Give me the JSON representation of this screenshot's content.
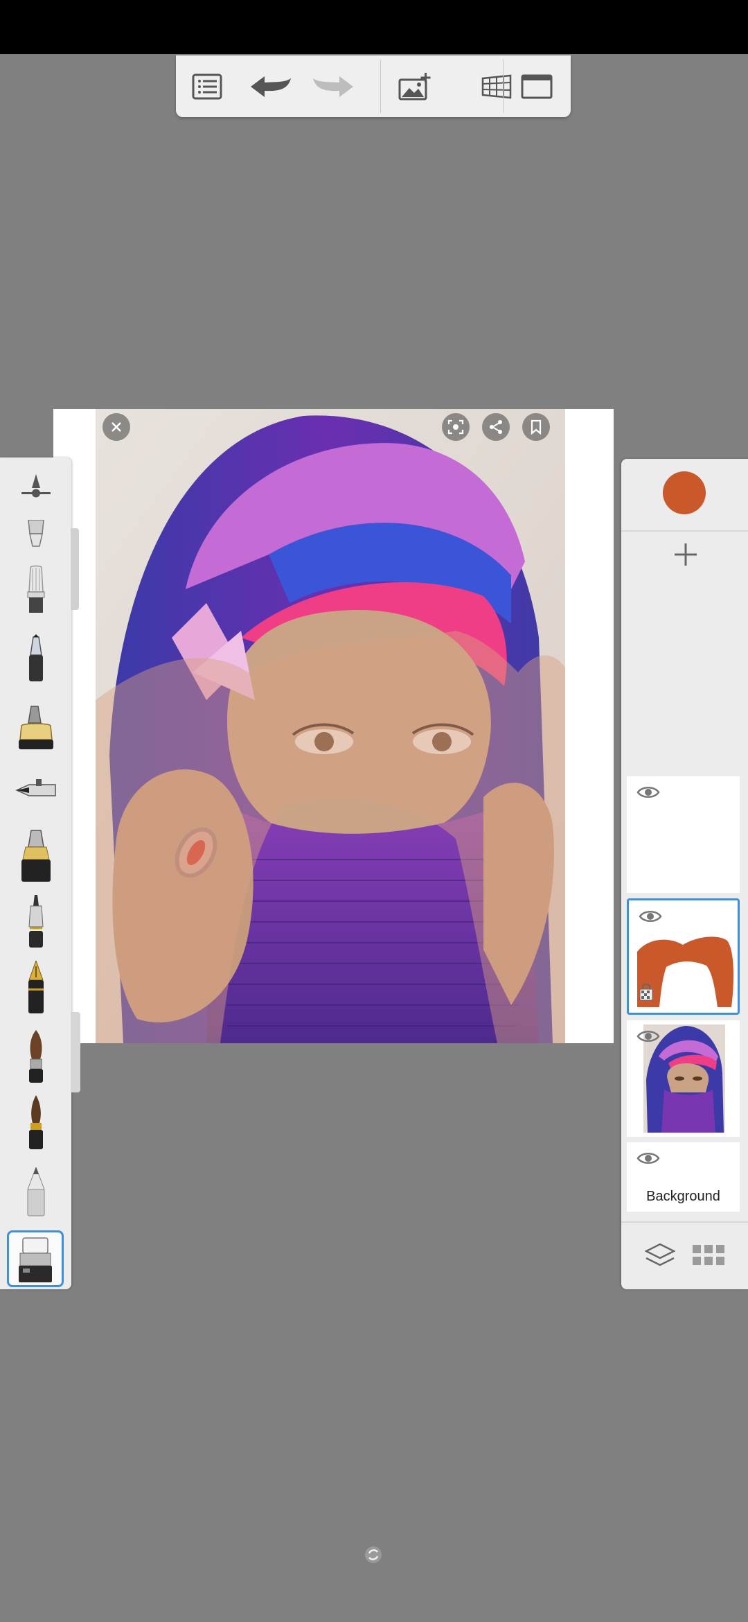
{
  "toolbar": {
    "buttons": [
      {
        "icon": "list-icon"
      },
      {
        "icon": "undo-icon"
      },
      {
        "icon": "redo-icon"
      },
      {
        "icon": "add-image-icon"
      },
      {
        "icon": "perspective-grid-icon"
      },
      {
        "icon": "fullscreen-icon"
      }
    ]
  },
  "canvas": {
    "overlay_buttons": [
      "close-icon",
      "capture-icon",
      "share-icon",
      "bookmark-icon"
    ]
  },
  "brushes": {
    "items": [
      "brush-settings-icon",
      "smudge-brush-icon",
      "airbrush-icon",
      "marker-icon",
      "chisel-marker-icon",
      "ballpoint-icon",
      "felt-pen-icon",
      "technical-pen-icon",
      "fountain-pen-icon",
      "paintbrush-icon",
      "ink-brush-icon",
      "pencil-icon",
      "eraser-icon"
    ],
    "selected": "eraser-icon"
  },
  "layers": {
    "current_color": "#c9592a",
    "items": [
      {
        "name": "",
        "visible": true
      },
      {
        "name": "",
        "visible": true,
        "selected": true
      },
      {
        "name": "",
        "visible": true
      },
      {
        "name": "Background",
        "visible": true
      }
    ]
  },
  "colors": {
    "accent": "#3d8fe0",
    "brush_color": "#c9592a",
    "canvas_bg": "#808080"
  }
}
